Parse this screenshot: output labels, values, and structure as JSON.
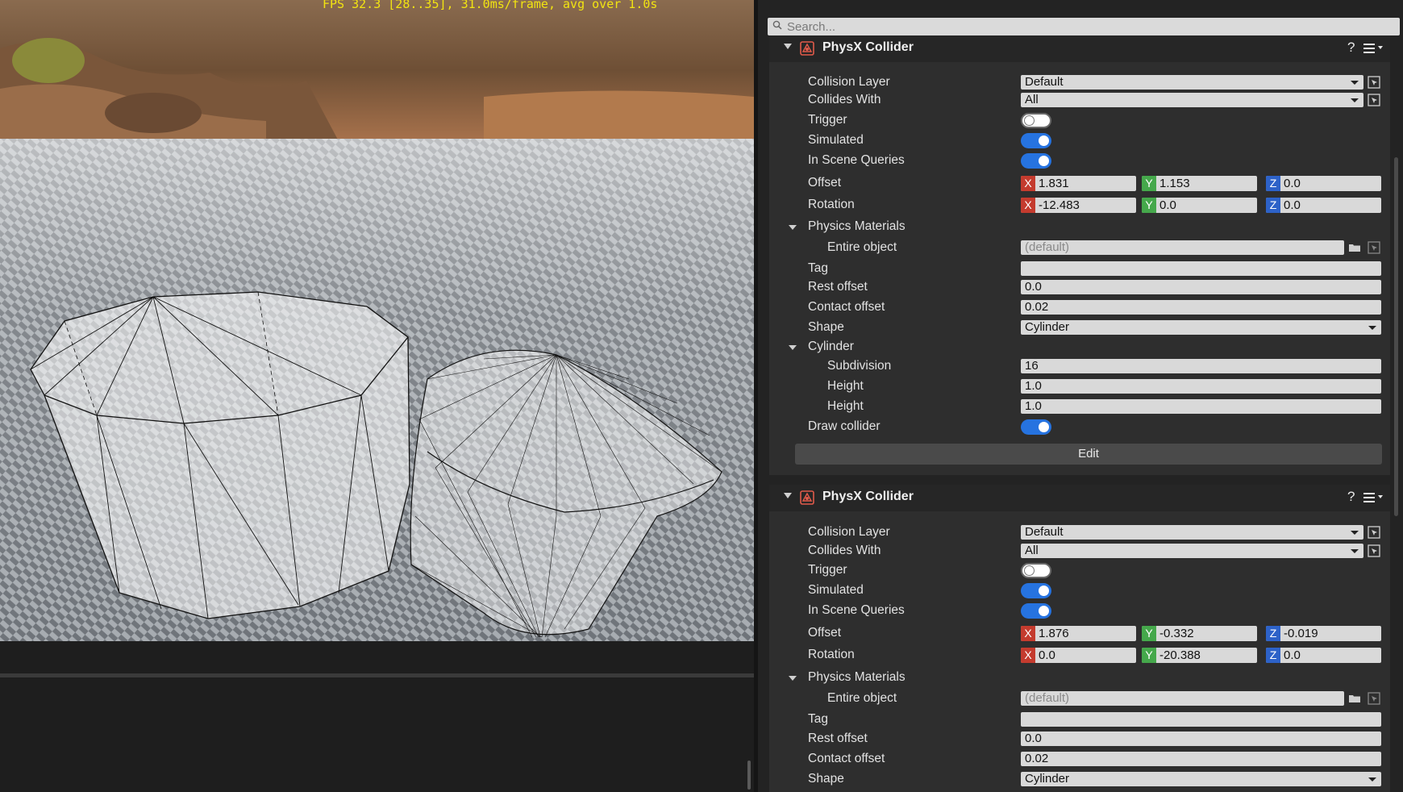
{
  "viewport": {
    "fps_text": "FPS 32.3 [28..35], 31.0ms/frame, avg over 1.0s"
  },
  "search": {
    "placeholder": "Search..."
  },
  "icons": {
    "search": "search-icon",
    "component": "physx-collider-icon",
    "help": "help-icon",
    "menu": "hamburger-menu-icon",
    "pick": "pick-in-viewport-icon",
    "browse": "folder-browse-icon"
  },
  "colors": {
    "toggle_on": "#2673e0",
    "axis_x": "#c43b2e",
    "axis_y": "#45a84b",
    "axis_z": "#2d62c8",
    "fps_text": "#f2e411"
  },
  "components": [
    {
      "title": "PhysX Collider",
      "help": "?",
      "collision_layer": {
        "label": "Collision Layer",
        "value": "Default"
      },
      "collides_with": {
        "label": "Collides With",
        "value": "All"
      },
      "trigger": {
        "label": "Trigger",
        "on": false
      },
      "simulated": {
        "label": "Simulated",
        "on": true
      },
      "in_scene_queries": {
        "label": "In Scene Queries",
        "on": true
      },
      "offset": {
        "label": "Offset",
        "x": "1.831",
        "y": "1.153",
        "z": "0.0"
      },
      "rotation": {
        "label": "Rotation",
        "x": "-12.483",
        "y": "0.0",
        "z": "0.0"
      },
      "physics_materials": {
        "label": "Physics Materials",
        "entire_object_label": "Entire object",
        "entire_object_value": "(default)"
      },
      "tag": {
        "label": "Tag",
        "value": ""
      },
      "rest_offset": {
        "label": "Rest offset",
        "value": "0.0"
      },
      "contact_offset": {
        "label": "Contact offset",
        "value": "0.02"
      },
      "shape": {
        "label": "Shape",
        "value": "Cylinder"
      },
      "cylinder": {
        "label": "Cylinder",
        "subdivision_label": "Subdivision",
        "subdivision": "16",
        "height_label": "Height",
        "height": "1.0",
        "height2_label": "Height",
        "height2": "1.0"
      },
      "draw_collider": {
        "label": "Draw collider",
        "on": true
      },
      "edit_label": "Edit",
      "axis_labels": {
        "x": "X",
        "y": "Y",
        "z": "Z"
      }
    },
    {
      "title": "PhysX Collider",
      "help": "?",
      "collision_layer": {
        "label": "Collision Layer",
        "value": "Default"
      },
      "collides_with": {
        "label": "Collides With",
        "value": "All"
      },
      "trigger": {
        "label": "Trigger",
        "on": false
      },
      "simulated": {
        "label": "Simulated",
        "on": true
      },
      "in_scene_queries": {
        "label": "In Scene Queries",
        "on": true
      },
      "offset": {
        "label": "Offset",
        "x": "1.876",
        "y": "-0.332",
        "z": "-0.019"
      },
      "rotation": {
        "label": "Rotation",
        "x": "0.0",
        "y": "-20.388",
        "z": "0.0"
      },
      "physics_materials": {
        "label": "Physics Materials",
        "entire_object_label": "Entire object",
        "entire_object_value": "(default)"
      },
      "tag": {
        "label": "Tag",
        "value": ""
      },
      "rest_offset": {
        "label": "Rest offset",
        "value": "0.0"
      },
      "contact_offset": {
        "label": "Contact offset",
        "value": "0.02"
      },
      "shape": {
        "label": "Shape",
        "value": "Cylinder"
      },
      "axis_labels": {
        "x": "X",
        "y": "Y",
        "z": "Z"
      }
    }
  ]
}
